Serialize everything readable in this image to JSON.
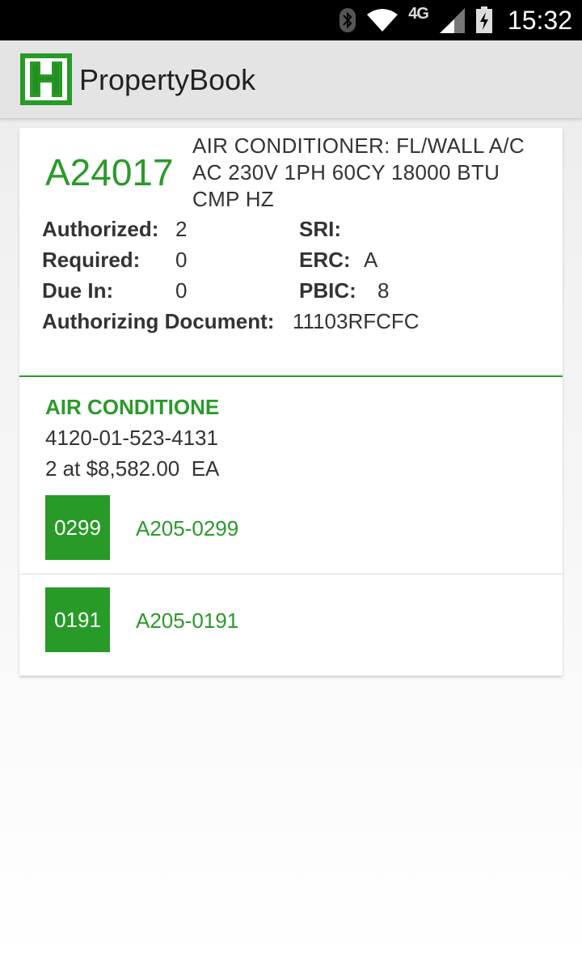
{
  "status_bar": {
    "time": "15:32",
    "network": "4G",
    "icons": [
      "bluetooth-icon",
      "wifi-icon",
      "signal-icon",
      "battery-charging-icon"
    ]
  },
  "app_bar": {
    "title": "PropertyBook",
    "logo_letter": "H"
  },
  "record": {
    "lin": "A24017",
    "nomenclature_lines": [
      "AIR CONDITIONER: FL/WALL A/C",
      "AC 230V 1PH 60CY 18000 BTU",
      "CMP HZ"
    ],
    "fields": {
      "authorized_label": "Authorized:",
      "authorized_value": "2",
      "sri_label": "SRI:",
      "sri_value": "",
      "required_label": "Required:",
      "required_value": "0",
      "erc_label": "ERC:",
      "erc_value": "A",
      "due_in_label": "Due In:",
      "due_in_value": "0",
      "pbic_label": "PBIC:",
      "pbic_value": "8",
      "auth_doc_label": "Authorizing Document:",
      "auth_doc_value": "11103RFCFC"
    }
  },
  "item": {
    "name": "AIR CONDITIONE",
    "nsn": "4120-01-523-4131",
    "quantity_text": "2 at $8,582.00  EA"
  },
  "serials": [
    {
      "badge": "0299",
      "serial": "A205-0299"
    },
    {
      "badge": "0191",
      "serial": "A205-0191"
    }
  ],
  "colors": {
    "accent_green": "#279a27",
    "status_bar": "#000000",
    "app_bar": "#e4e4e4"
  }
}
